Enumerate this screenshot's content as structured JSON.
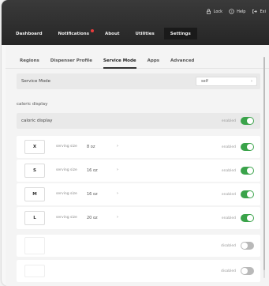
{
  "toolbar": {
    "lock_label": "Lock",
    "help_label": "Help",
    "exit_label": "Exi"
  },
  "nav": {
    "tabs": [
      "Dashboard",
      "Notifications",
      "About",
      "Utilities",
      "Settings"
    ],
    "active": "Settings"
  },
  "subtabs": {
    "items": [
      "Regions",
      "Dispenser Profile",
      "Service Mode",
      "Apps",
      "Advanced"
    ],
    "active": "Service Mode"
  },
  "service_mode": {
    "label": "Service Mode",
    "value": "self"
  },
  "caloric_section_title": "caloric display",
  "caloric_row": {
    "label": "caloric display",
    "status": "enabled",
    "enabled": true
  },
  "sizes": [
    {
      "size": "X",
      "label": "serving size",
      "value": "8 oz",
      "status": "enabled",
      "enabled": true
    },
    {
      "size": "S",
      "label": "serving size",
      "value": "16 oz",
      "status": "enabled",
      "enabled": true
    },
    {
      "size": "M",
      "label": "serving size",
      "value": "16 oz",
      "status": "enabled",
      "enabled": true
    },
    {
      "size": "L",
      "label": "serving size",
      "value": "20 oz",
      "status": "enabled",
      "enabled": true
    },
    {
      "size": "",
      "label": "",
      "value": "",
      "status": "disabled",
      "enabled": false
    },
    {
      "size": "",
      "label": "",
      "value": "",
      "status": "disabled",
      "enabled": false
    }
  ],
  "colors": {
    "toggle_on": "#3aa34a",
    "toggle_off": "#b9b9b9",
    "notification_dot": "#e83b3b"
  }
}
